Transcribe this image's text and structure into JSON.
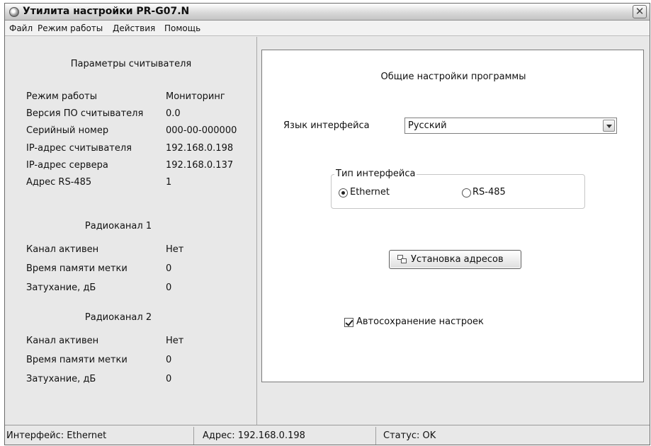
{
  "window": {
    "title": "Утилита настройки PR-G07.N",
    "close_glyph": "✕"
  },
  "menu": {
    "items": [
      "Файл",
      "Режим работы",
      "Действия",
      "Помощь"
    ]
  },
  "left": {
    "reader_title": "Параметры считывателя",
    "reader": [
      {
        "label": "Режим работы",
        "value": "Мониторинг"
      },
      {
        "label": "Версия ПО считывателя",
        "value": "0.0"
      },
      {
        "label": "Серийный номер",
        "value": "000-00-000000"
      },
      {
        "label": "IP-адрес считывателя",
        "value": "192.168.0.198"
      },
      {
        "label": "IP-адрес сервера",
        "value": "192.168.0.137"
      },
      {
        "label": "Адрес RS-485",
        "value": "1"
      }
    ],
    "radio1": {
      "title": "Радиоканал 1",
      "rows": [
        {
          "label": "Канал активен",
          "value": "Нет"
        },
        {
          "label": "Время памяти метки",
          "value": "0"
        },
        {
          "label": "Затухание, дБ",
          "value": "0"
        }
      ]
    },
    "radio2": {
      "title": "Радиоканал 2",
      "rows": [
        {
          "label": "Канал активен",
          "value": "Нет"
        },
        {
          "label": "Время памяти метки",
          "value": "0"
        },
        {
          "label": "Затухание, дБ",
          "value": "0"
        }
      ]
    }
  },
  "settings": {
    "title": "Общие настройки программы",
    "language_label": "Язык интерфейса",
    "language_value": "Русский",
    "interface_group": "Тип интерфейса",
    "interface_options": [
      {
        "label": "Ethernet",
        "checked": true
      },
      {
        "label": "RS-485",
        "checked": false
      }
    ],
    "set_address_button": "Установка адресов",
    "autosave_label": "Автосохранение настроек",
    "autosave_checked": true
  },
  "status": {
    "interface": "Интерфейс: Ethernet",
    "address": "Адрес: 192.168.0.198",
    "status": "Статус: OK"
  }
}
